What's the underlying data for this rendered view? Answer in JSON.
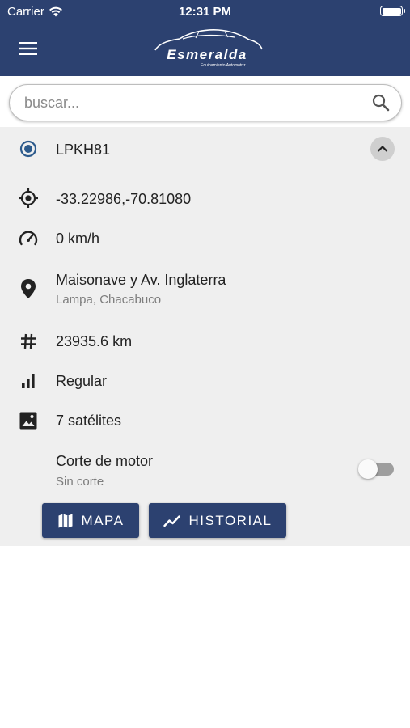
{
  "status_bar": {
    "carrier": "Carrier",
    "time": "12:31 PM"
  },
  "header": {
    "logo_text": "Esmeralda",
    "logo_subtitle": "Equipamiento Automotriz",
    "menu_icon": "hamburger-menu-icon"
  },
  "search": {
    "placeholder": "buscar...",
    "value": "",
    "icon": "search-icon"
  },
  "vehicle": {
    "plate": "LPKH81",
    "coordinates": "-33.22986,-70.81080",
    "speed": "0 km/h",
    "address": "Maisonave y Av. Inglaterra",
    "locality": "Lampa, Chacabuco",
    "odometer": "23935.6 km",
    "signal": "Regular",
    "satellites": "7 satélites",
    "engine_cut_label": "Corte de motor",
    "engine_cut_status": "Sin corte",
    "engine_cut_enabled": false
  },
  "actions": {
    "map_label": "MAPA",
    "history_label": "HISTORIAL"
  },
  "colors": {
    "primary": "#2c4170",
    "panel_bg": "#efefef",
    "link": "#1a1adb",
    "muted": "#7d7d7d"
  }
}
